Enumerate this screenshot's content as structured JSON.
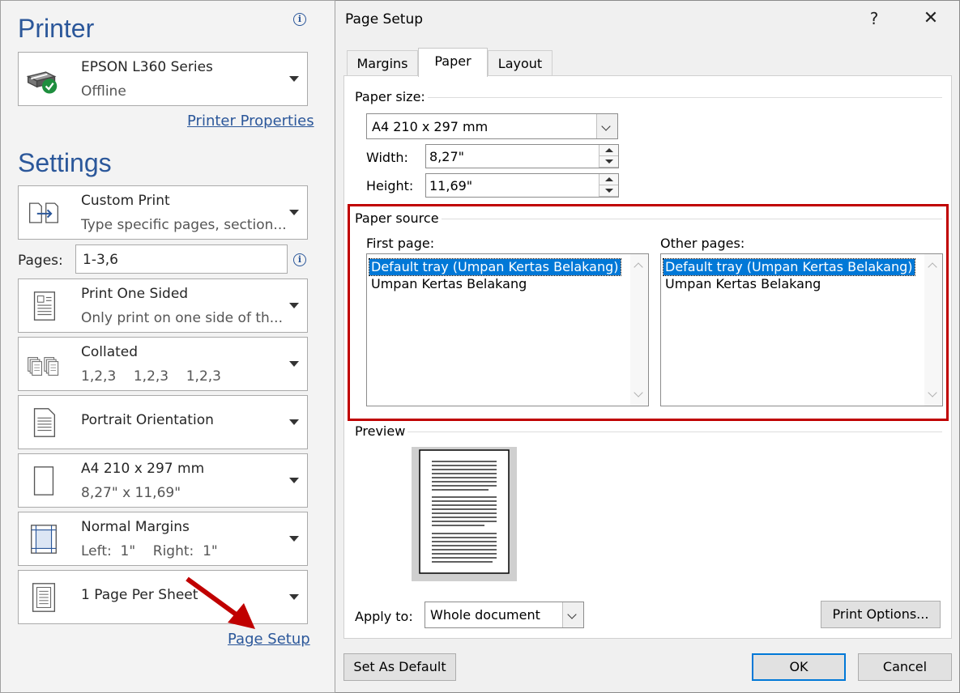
{
  "left": {
    "printer_heading": "Printer",
    "printer": {
      "name": "EPSON L360 Series",
      "status": "Offline"
    },
    "printer_properties_link": "Printer Properties",
    "settings_heading": "Settings",
    "print_range": {
      "title": "Custom Print",
      "subtitle": "Type specific pages, section..."
    },
    "pages_label": "Pages:",
    "pages_value": "1-3,6",
    "sides": {
      "title": "Print One Sided",
      "subtitle": "Only print on one side of th..."
    },
    "collation": {
      "title": "Collated",
      "subtitle": "1,2,3    1,2,3    1,2,3"
    },
    "orientation": {
      "title": "Portrait Orientation"
    },
    "paper": {
      "title": "A4 210 x 297 mm",
      "subtitle": "8,27\" x 11,69\""
    },
    "margins": {
      "title": "Normal Margins",
      "subtitle": "Left:  1\"    Right:  1\""
    },
    "per_sheet": {
      "title": "1 Page Per Sheet"
    },
    "page_setup_link": "Page Setup"
  },
  "dialog": {
    "title": "Page Setup",
    "help_glyph": "?",
    "close_glyph": "✕",
    "tabs": [
      "Margins",
      "Paper",
      "Layout"
    ],
    "active_tab": "Paper",
    "paper_size_label": "Paper size:",
    "paper_size_value": "A4 210 x 297 mm",
    "width_label": "Width:",
    "width_value": "8,27\"",
    "height_label": "Height:",
    "height_value": "11,69\"",
    "paper_source_label": "Paper source",
    "first_page_label": "First page:",
    "other_pages_label": "Other pages:",
    "first_page_items": [
      "Default tray (Umpan Kertas Belakang)",
      "Umpan Kertas Belakang"
    ],
    "other_pages_items": [
      "Default tray (Umpan Kertas Belakang)",
      "Umpan Kertas Belakang"
    ],
    "preview_label": "Preview",
    "apply_to_label": "Apply to:",
    "apply_to_value": "Whole document",
    "print_options_button": "Print Options...",
    "set_default_button": "Set As Default",
    "ok_button": "OK",
    "cancel_button": "Cancel"
  },
  "colors": {
    "accent": "#2b579a",
    "highlight_box": "#c00000",
    "selection": "#0078d7",
    "arrow": "#c00000"
  }
}
